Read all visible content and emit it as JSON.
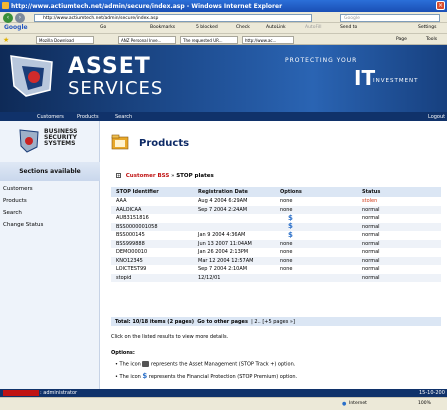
{
  "browser": {
    "window_title": "http://www.actiumtech.net/admin/secure/index.asp - Windows Internet Explorer",
    "address": "http://www.actiumtech.net/admin/secure/index.asp",
    "search_placeholder": "Google",
    "google_label": "Google",
    "go_label": "Go",
    "toolbar_items": [
      "Bookmarks",
      "5 blocked",
      "Check",
      "AutoLink",
      "AutoFill",
      "Send to",
      "Settings"
    ],
    "favorites": [
      "Mozilla Download",
      "ANZ Personal Inve...",
      "The requested UR...",
      "http://www.ac..."
    ],
    "page_menu": "Page",
    "tools_menu": "Tools",
    "zone": "Internet",
    "zoom": "100%"
  },
  "banner": {
    "asset": "ASSET",
    "services": "SERVICES",
    "protecting": "PROTECTING YOUR",
    "it": "IT",
    "investment": "INVESTMENT"
  },
  "menu": {
    "items": [
      "Customers",
      "Products",
      "Search"
    ],
    "logout": "Logout"
  },
  "sidebar": {
    "bss_lines": [
      "BUSINESS",
      "SECURITY",
      "SYSTEMS"
    ],
    "heading": "Sections available",
    "links": [
      "Customers",
      "Products",
      "Search",
      "Change Status"
    ]
  },
  "page": {
    "title": "Products",
    "crumb_link": "Customer BSS",
    "crumb_sep": " » ",
    "crumb_current": "STOP plates"
  },
  "table": {
    "headers": [
      "STOP Identifier",
      "Registration Date",
      "Options",
      "Status"
    ],
    "rows": [
      {
        "id": "AAA",
        "date": "Aug 4 2004 6:29AM",
        "option": "none",
        "status": "stolen"
      },
      {
        "id": "AALOICAA",
        "date": "Sep 7 2004 2:24AM",
        "option": "none",
        "status": "normal"
      },
      {
        "id": "AUB3151816",
        "date": "",
        "option": "$",
        "status": "normal"
      },
      {
        "id": "BSS0000001058",
        "date": "",
        "option": "$",
        "status": "normal"
      },
      {
        "id": "BSS000145",
        "date": "Jan 9 2004 4:36AM",
        "option": "$",
        "status": "normal"
      },
      {
        "id": "BSS999888",
        "date": "Jun 13 2007 11:04AM",
        "option": "none",
        "status": "normal"
      },
      {
        "id": "DEMO00010",
        "date": "Jan 26 2004 2:13PM",
        "option": "none",
        "status": "normal"
      },
      {
        "id": "KNO12345",
        "date": "Mar 12 2004 12:57AM",
        "option": "none",
        "status": "normal"
      },
      {
        "id": "LOICTEST99",
        "date": "Sep 7 2004 2:10AM",
        "option": "none",
        "status": "normal"
      },
      {
        "id": "stopid",
        "date": "12/12/01",
        "option": "",
        "status": "normal"
      }
    ]
  },
  "pager": {
    "total": "Total: 10/18 items (2 pages)",
    "goto": "Go to other pages",
    "pages": "| 2.. [+5 pages »]"
  },
  "hint": "Click on the listed results to view more details.",
  "options": {
    "heading": "Options:",
    "line1_pre": "The icon",
    "line1_post": "represents the Asset Management (STOP Track +) option.",
    "line2_pre": "The icon",
    "line2_post": "represents the Financial Protection (STOP Premium) option."
  },
  "footer": {
    "user": ": administrator",
    "date": "15-10-200"
  },
  "colors": {
    "navy": "#10326a",
    "accent_red": "#c01414",
    "status_red": "#d13b1a"
  }
}
